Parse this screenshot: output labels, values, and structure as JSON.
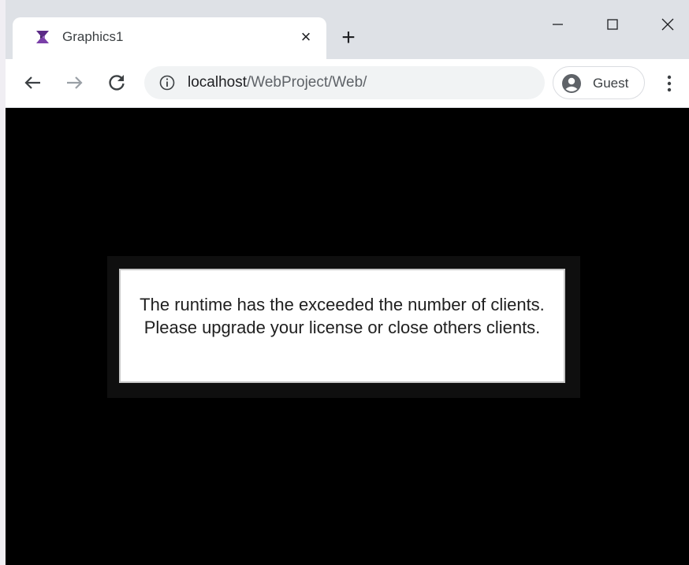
{
  "tab": {
    "title": "Graphics1",
    "close_glyph": "×",
    "favicon": "app-logo-icon"
  },
  "new_tab_glyph": "+",
  "window_controls": {
    "minimize": "–",
    "maximize": "☐",
    "close": "✕"
  },
  "toolbar": {
    "url_host": "localhost",
    "url_path": "/WebProject/Web/",
    "profile_label": "Guest"
  },
  "dialog": {
    "message": "The runtime has the exceeded the number of clients. Please upgrade your license or close others clients."
  },
  "colors": {
    "tabstrip": "#dee1e6",
    "content_background": "#000000",
    "dialog_background": "#ffffff",
    "favicon_purple": "#5b2a86"
  }
}
